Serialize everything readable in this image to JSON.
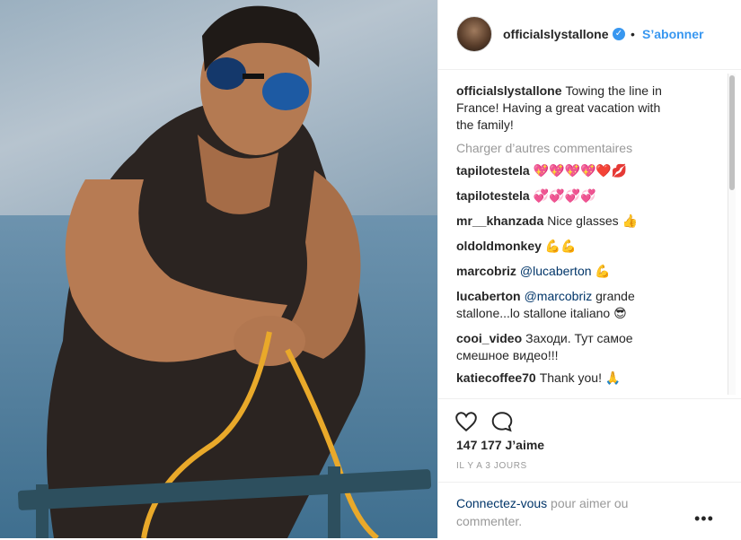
{
  "header": {
    "username": "officialslystallone",
    "separator": "•",
    "follow_label": "S’abonner"
  },
  "caption": {
    "username": "officialslystallone",
    "text": "Towing the line in France! Having a great vacation with the family!"
  },
  "load_more_label": "Charger d’autres commentaires",
  "comments": [
    {
      "username": "tapilotestela",
      "text": "💖💖💖💖❤️💋"
    },
    {
      "username": "tapilotestela",
      "text": "💞💞💞💞"
    },
    {
      "username": "mr__khanzada",
      "text": "Nice glasses 👍"
    },
    {
      "username": "oldoldmonkey",
      "text": "💪💪"
    },
    {
      "username": "marcobriz",
      "mention": "@lucaberton",
      "text": " 💪"
    },
    {
      "username": "lucaberton",
      "mention": "@marcobriz",
      "text": " grande stallone...lo stallone italiano 😎"
    },
    {
      "username": "cooi_video",
      "text": "Заходи. Тут самое смешное видео!!!"
    },
    {
      "username": "katiecoffee70",
      "text": "Thank you! 🙏"
    }
  ],
  "likes_label": "147 177 J’aime",
  "timestamp": "IL Y A 3 JOURS",
  "login": {
    "link": "Connectez-vous",
    "text": " pour aimer ou commenter."
  },
  "more_label": "•••",
  "icons": [
    "verified-badge-icon",
    "heart-icon",
    "comment-icon",
    "more-options-icon"
  ]
}
